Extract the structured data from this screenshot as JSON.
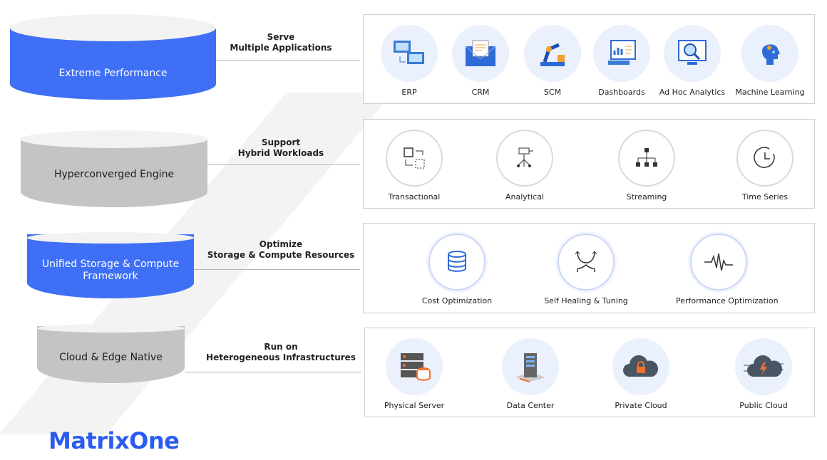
{
  "logo": "MatrixOne",
  "colors": {
    "blue": "#3e6ff5",
    "gray": "#c4c4c4"
  },
  "layers": [
    {
      "label": "Extreme Performance",
      "caption_line1": "Serve",
      "caption_line2": "Multiple Applications",
      "items": [
        {
          "label": "ERP",
          "icon": "erp-computers-icon"
        },
        {
          "label": "CRM",
          "icon": "crm-envelope-icon"
        },
        {
          "label": "SCM",
          "icon": "scm-robot-arm-icon"
        },
        {
          "label": "Dashboards",
          "icon": "dashboard-icon"
        },
        {
          "label": "Ad Hoc Analytics",
          "icon": "analytics-magnifier-icon"
        },
        {
          "label": "Machine Learning",
          "icon": "ml-head-icon"
        }
      ]
    },
    {
      "label": "Hyperconverged Engine",
      "caption_line1": "Support",
      "caption_line2": "Hybrid Workloads",
      "items": [
        {
          "label": "Transactional",
          "icon": "transaction-icon"
        },
        {
          "label": "Analytical",
          "icon": "analytical-icon"
        },
        {
          "label": "Streaming",
          "icon": "hierarchy-icon"
        },
        {
          "label": "Time Series",
          "icon": "clock-icon"
        }
      ]
    },
    {
      "label": "Unified Storage & Compute Framework",
      "caption_line1": "Optimize",
      "caption_line2": "Storage & Compute Resources",
      "items": [
        {
          "label": "Cost Optimization",
          "icon": "coin-stack-icon"
        },
        {
          "label": "Self Healing & Tuning",
          "icon": "arrows-icon"
        },
        {
          "label": "Performance Optimization",
          "icon": "waveform-icon"
        }
      ]
    },
    {
      "label": "Cloud & Edge Native",
      "caption_line1": "Run on",
      "caption_line2": "Heterogeneous Infrastructures",
      "items": [
        {
          "label": "Physical Server",
          "icon": "server-icon"
        },
        {
          "label": "Data Center",
          "icon": "data-center-icon"
        },
        {
          "label": "Private Cloud",
          "icon": "private-cloud-icon"
        },
        {
          "label": "Public Cloud",
          "icon": "public-cloud-icon"
        }
      ]
    }
  ]
}
